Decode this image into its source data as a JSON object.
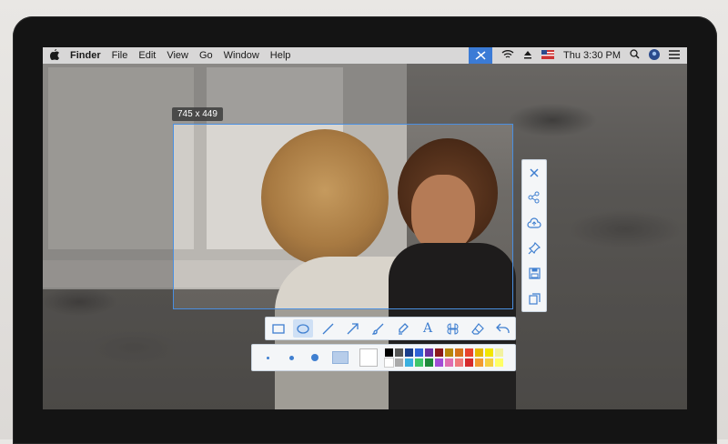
{
  "menubar": {
    "apple": "",
    "items": [
      "Finder",
      "File",
      "Edit",
      "View",
      "Go",
      "Window",
      "Help"
    ],
    "clock": "Thu 3:30 PM"
  },
  "selection": {
    "size_label": "745 x 449"
  },
  "side_toolbar": [
    "close-icon",
    "share-icon",
    "upload-cloud-icon",
    "pin-icon",
    "save-icon",
    "copy-icon"
  ],
  "draw_tools": [
    "rectangle-icon",
    "ellipse-icon",
    "line-icon",
    "arrow-icon",
    "brush-icon",
    "marker-icon",
    "text-icon",
    "mosaic-icon",
    "eraser-icon",
    "undo-icon"
  ],
  "text_tool_label": "A",
  "palette": [
    "#000000",
    "#555555",
    "#1a3e8c",
    "#2f63d6",
    "#6a2fa0",
    "#8b1a1a",
    "#b8860b",
    "#d4731a",
    "#e8442d",
    "#e6b800",
    "#f2e600",
    "#f2f2a0",
    "#ffffff",
    "#aaaaaa",
    "#3ab0e0",
    "#3fc86a",
    "#1f8a3a",
    "#a34dd6",
    "#e06fb0",
    "#f07a7a",
    "#d62b2b",
    "#f29b30",
    "#f5d040",
    "#ffff66"
  ]
}
